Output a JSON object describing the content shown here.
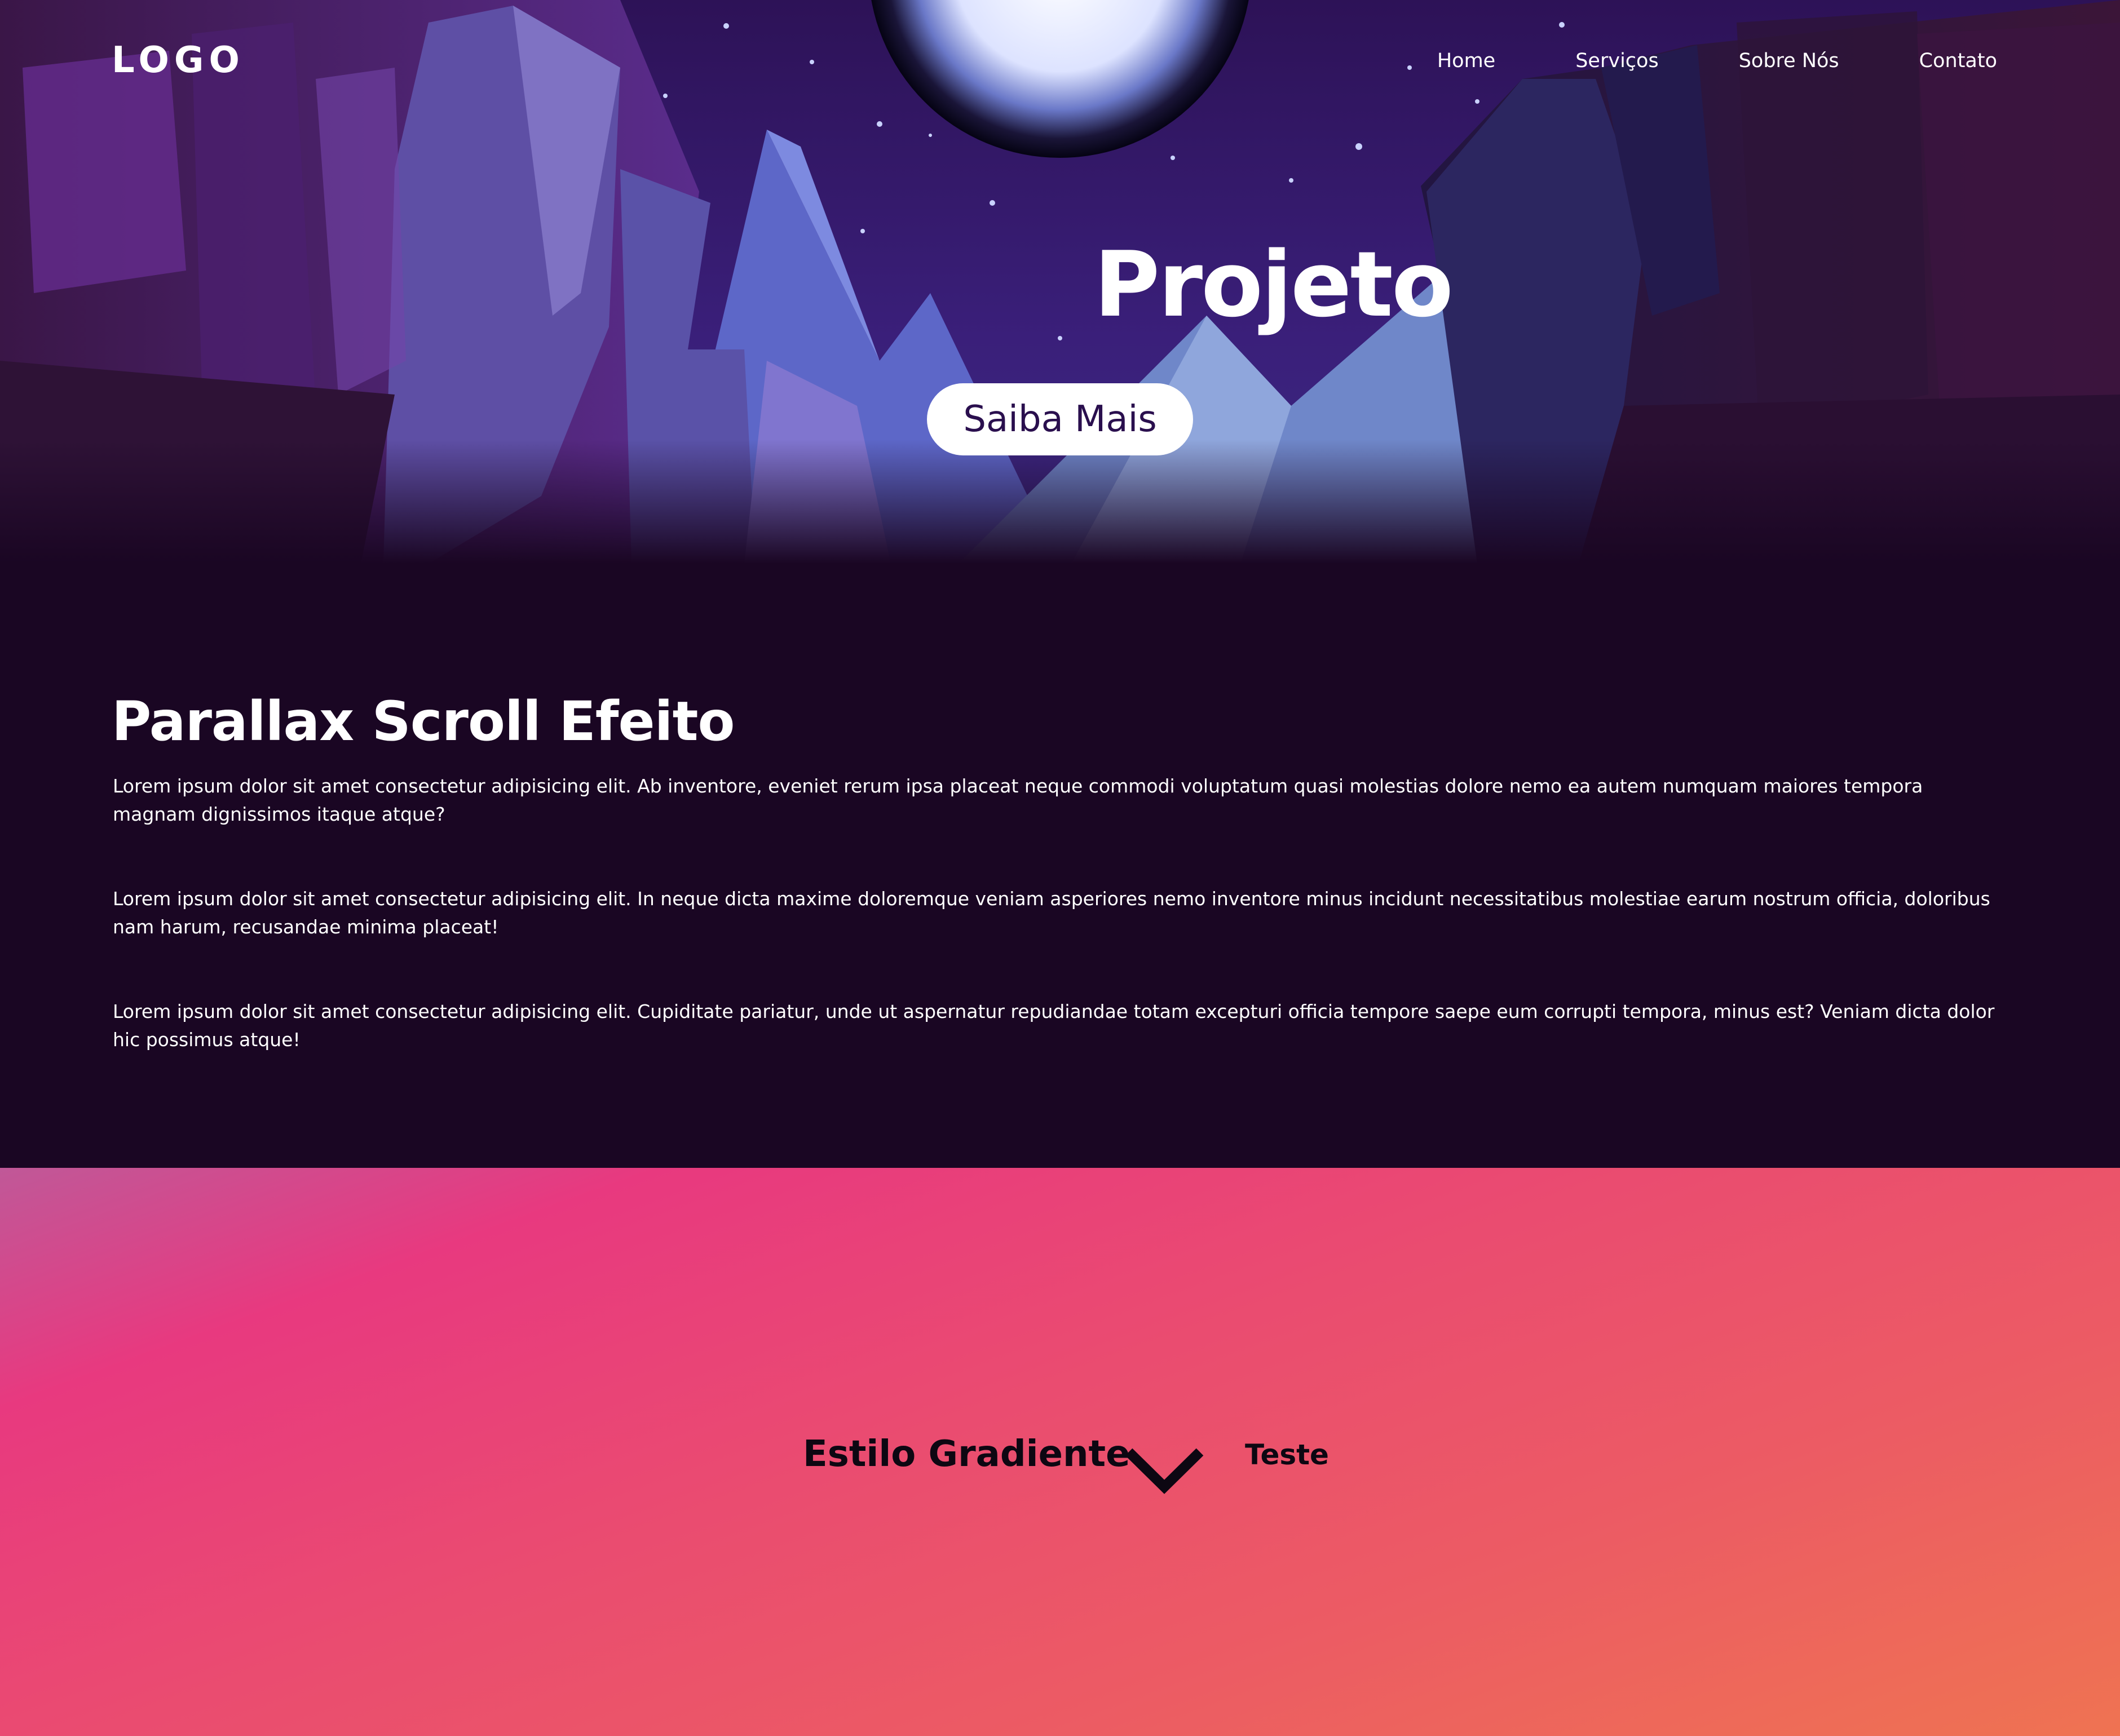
{
  "header": {
    "logo": "LOGO",
    "nav": [
      {
        "label": "Home"
      },
      {
        "label": "Serviços"
      },
      {
        "label": "Sobre Nós"
      },
      {
        "label": "Contato"
      }
    ]
  },
  "hero": {
    "title": "Projeto",
    "button_label": "Saiba Mais"
  },
  "content": {
    "title": "Parallax Scroll Efeito",
    "paragraphs": [
      "Lorem ipsum dolor sit amet consectetur adipisicing elit. Ab inventore, eveniet rerum ipsa placeat neque commodi voluptatum quasi molestias dolore nemo ea autem numquam maiores tempora magnam dignissimos itaque atque?",
      "Lorem ipsum dolor sit amet consectetur adipisicing elit. In neque dicta maxime doloremque veniam asperiores nemo inventore minus incidunt necessitatibus molestiae earum nostrum officia, doloribus nam harum, recusandae minima placeat!",
      "Lorem ipsum dolor sit amet consectetur adipisicing elit. Cupiditate pariatur, unde ut aspernatur repudiandae totam excepturi officia tempore saepe eum corrupti tempora, minus est? Veniam dicta dolor hic possimus atque!"
    ]
  },
  "gradient_section": {
    "title": "Estilo Gradiente",
    "side_label": "Teste",
    "chevron_icon": "chevron-down-icon"
  },
  "colors": {
    "page_background": "#1a0623",
    "button_text": "#2a0f4e",
    "gradient_pink": "#e8397f",
    "gradient_orange": "#ef7352"
  }
}
